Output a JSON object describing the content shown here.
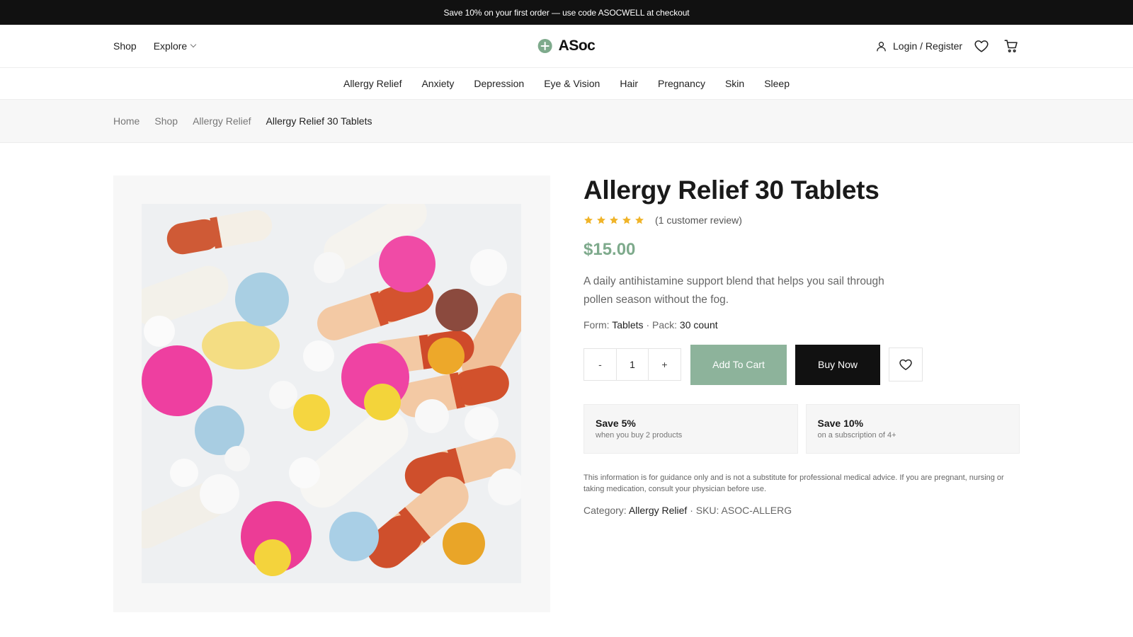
{
  "promo": {
    "text": "Save 10% on your first order — use code ASOCWELL at checkout"
  },
  "header": {
    "nav": [
      {
        "label": "Shop"
      },
      {
        "label": "Explore"
      }
    ],
    "brand": "ASoc",
    "login_label": "Login / Register",
    "icons": {
      "account": "user-icon",
      "wishlist": "heart-icon",
      "cart": "cart-icon"
    }
  },
  "categories": [
    "Allergy Relief",
    "Anxiety",
    "Depression",
    "Eye & Vision",
    "Hair",
    "Pregnancy",
    "Skin",
    "Sleep"
  ],
  "breadcrumb": {
    "items": [
      "Home",
      "Shop",
      "Allergy Relief"
    ],
    "current": "Allergy Relief 30 Tablets"
  },
  "product": {
    "title": "Allergy Relief 30 Tablets",
    "rating": 5,
    "review_text": "(1 customer review)",
    "price": "$15.00",
    "description": "A daily antihistamine support blend that helps you sail through pollen season without the fog.",
    "form_label": "Form:",
    "form_value": "Tablets",
    "pack_label": "· Pack:",
    "pack_value": "30 count",
    "quantity": "1",
    "qty_minus": "-",
    "qty_plus": "+",
    "add_to_cart": "Add To Cart",
    "buy_now": "Buy Now",
    "offers": [
      {
        "title": "Save 5%",
        "subtitle": "when you buy 2 products"
      },
      {
        "title": "Save 10%",
        "subtitle": "on a subscription of 4+"
      }
    ],
    "disclaimer": "This information is for guidance only and is not a substitute for professional medical advice. If you are pregnant, nursing or taking medication, consult your physician before use.",
    "category_label": "Category:",
    "category_value": "Allergy Relief",
    "sku_text": "· SKU: ASOC-ALLERG"
  },
  "colors": {
    "accent": "#7eaa8c",
    "button_cart": "#8db39b",
    "star": "#f0b429",
    "dark": "#111111"
  }
}
